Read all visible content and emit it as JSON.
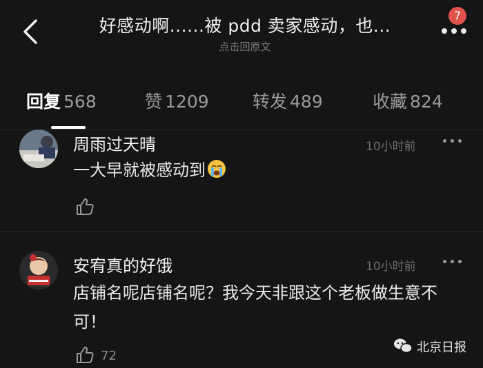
{
  "header": {
    "title": "好感动啊......被 pdd 卖家感动，也...",
    "subtitle": "点击回原文",
    "badge_count": "7",
    "icons": [
      "back-arrow-icon",
      "more-dots-icon"
    ]
  },
  "tabs": [
    {
      "label": "回复",
      "count": "568",
      "active": true
    },
    {
      "label": "赞",
      "count": "1209",
      "active": false
    },
    {
      "label": "转发",
      "count": "489",
      "active": false
    },
    {
      "label": "收藏",
      "count": "824",
      "active": false
    }
  ],
  "comments": [
    {
      "username": "周雨过天晴",
      "time": "10小时前",
      "text": "一大早就被感动到",
      "emoji": "crying-face",
      "likes": ""
    },
    {
      "username": "安宥真的好饿",
      "time": "10小时前",
      "text": "店铺名呢店铺名呢？我今天非跟这个老板做生意不可！",
      "emoji": "",
      "likes": "72"
    }
  ],
  "watermark": {
    "text": "北京日报"
  },
  "colors": {
    "background": "#151515",
    "badge": "#e0524a",
    "text": "#e6e6e6",
    "muted": "#6c6c6c"
  }
}
